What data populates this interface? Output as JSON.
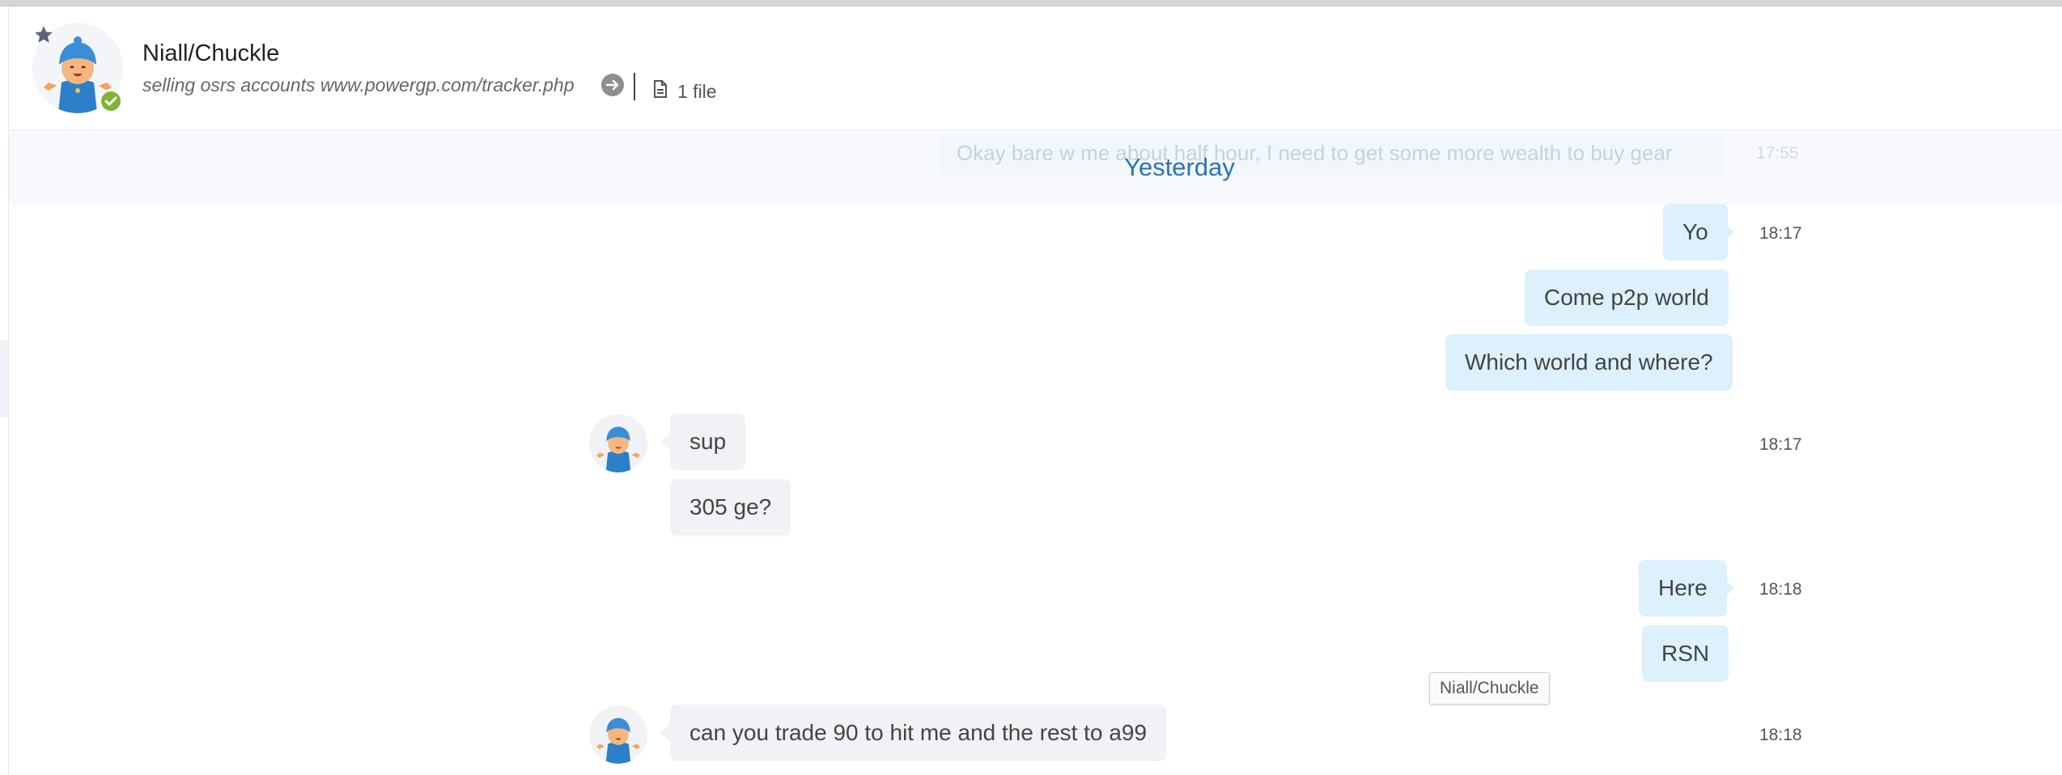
{
  "header": {
    "contact_name": "Niall/Chuckle",
    "status_message": "selling osrs accounts www.powergp.com/tracker.php",
    "files_label": "1 file"
  },
  "previous_message": {
    "text": "Okay bare w me about half hour, I need to get some more wealth to buy gear",
    "time": "17:55"
  },
  "day_divider": "Yesterday",
  "messages": [
    {
      "direction": "outgoing",
      "text": "Yo",
      "time": "18:17"
    },
    {
      "direction": "outgoing",
      "text": "Come p2p world"
    },
    {
      "direction": "outgoing",
      "text": "Which world and where?"
    },
    {
      "direction": "incoming",
      "text": "sup",
      "time": "18:17"
    },
    {
      "direction": "incoming",
      "text": "305 ge?"
    },
    {
      "direction": "outgoing",
      "text": "Here",
      "time": "18:18"
    },
    {
      "direction": "outgoing",
      "text": "RSN"
    },
    {
      "direction": "incoming",
      "text": "can you trade 90 to hit me and the rest to a99",
      "time": "18:18"
    }
  ],
  "tooltip": "Niall/Chuckle",
  "colors": {
    "outgoing_bubble": "#dcf1fb",
    "incoming_bubble": "#f0f2f5",
    "day_divider": "#2a76b5",
    "online_badge": "#80b33a"
  },
  "icons": [
    "star-icon",
    "checkmark-icon",
    "arrow-right-circle-icon",
    "file-icon"
  ]
}
